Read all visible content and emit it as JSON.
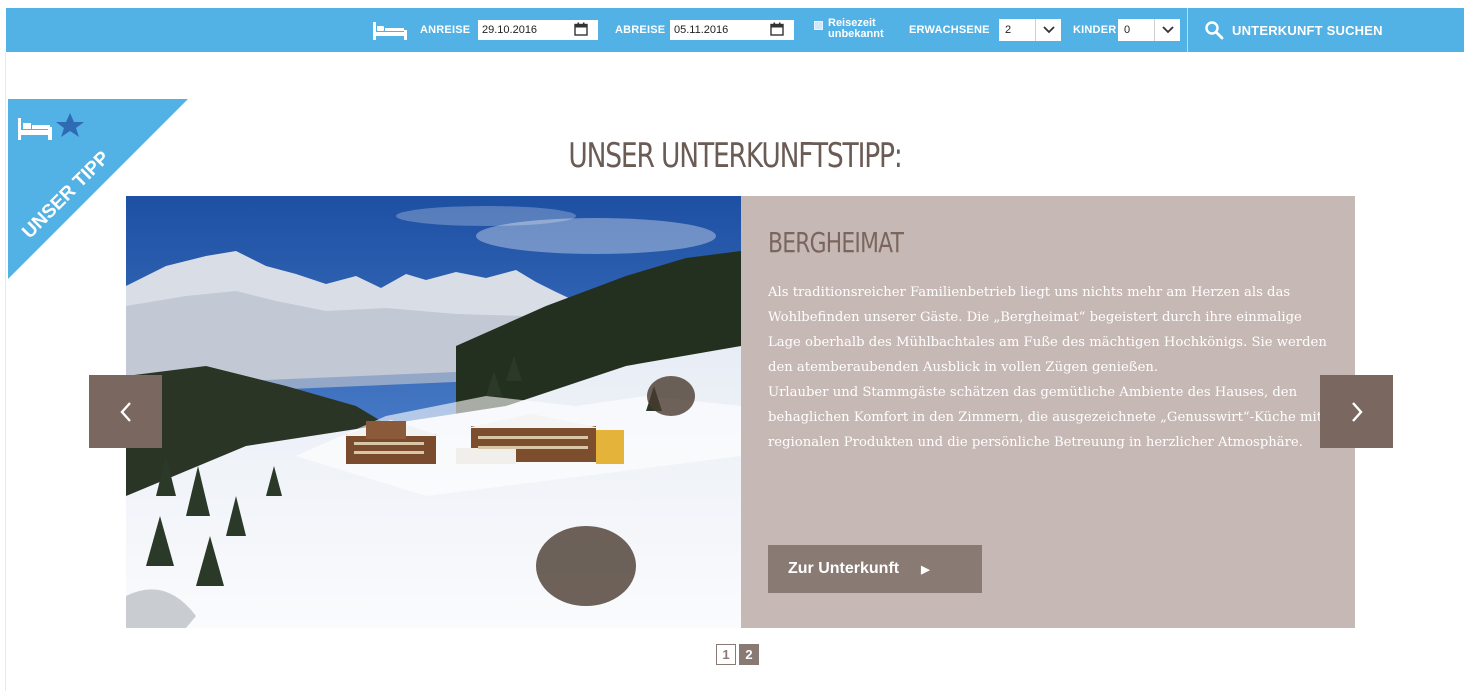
{
  "searchbar": {
    "anreise_label": "ANREISE",
    "anreise_value": "29.10.2016",
    "abreise_label": "ABREISE",
    "abreise_value": "05.11.2016",
    "reisezeit_line1": "Reisezeit",
    "reisezeit_line2": "unbekannt",
    "erwachsene_label": "ERWACHSENE",
    "erwachsene_value": "2",
    "kinder_label": "KINDER",
    "kinder_value": "0",
    "search_label": "UNTERKUNFT SUCHEN",
    "bar_color": "#52b1e5"
  },
  "ribbon": {
    "label": "UNSER TIPP",
    "icon": "bed-star-icon",
    "color": "#52b1e5"
  },
  "heading": "UNSER UNTERKUNFTSTIPP:",
  "slide": {
    "title": "BERGHEIMAT",
    "paragraph1": "Als traditionsreicher Familienbetrieb liegt uns nichts mehr am Herzen als das Wohlbefinden unserer Gäste. Die „Bergheimat“ begeistert durch ihre einmalige Lage oberhalb des Mühlbachtales am Fuße des mächtigen Hochkönigs. Sie werden den atemberaubenden Ausblick in vollen Zügen genießen.",
    "paragraph2": "Urlauber und Stammgäste schätzen das gemütliche Ambiente des Hauses, den behaglichen Komfort in den Zimmern, die ausgezeichnete „Genusswirt“-Küche mit regionalen Produkten und die persönliche Betreuung in herzlicher Atmosphäre.",
    "cta_label": "Zur Unterkunft",
    "image": "winter-mountain-hotel-photo",
    "panel_color": "#c6b8b4",
    "accent_color": "#8a7a74"
  },
  "pager": {
    "pages": [
      "1",
      "2"
    ],
    "active": "2"
  }
}
